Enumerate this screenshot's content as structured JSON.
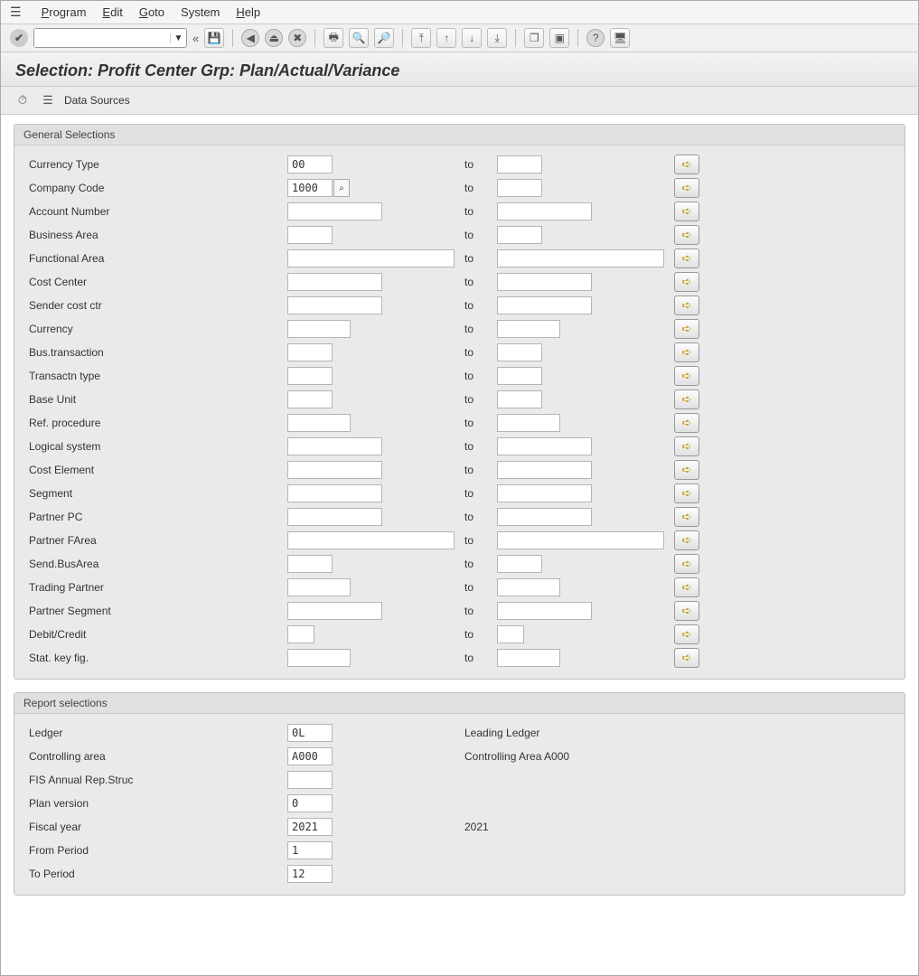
{
  "menubar": {
    "items": [
      "Program",
      "Edit",
      "Goto",
      "System",
      "Help"
    ]
  },
  "toolbar": {
    "combo_value": "",
    "chevrons": "«"
  },
  "title": "Selection: Profit Center Grp: Plan/Actual/Variance",
  "subtoolbar": {
    "data_sources": "Data Sources"
  },
  "general_selections": {
    "title": "General Selections",
    "to_label": "to",
    "rows": [
      {
        "label": "Currency Type",
        "from": "00",
        "from_w": "w2",
        "to_w": "w2",
        "f4": false
      },
      {
        "label": "Company Code",
        "from": "1000",
        "from_w": "w2",
        "to_w": "w2",
        "f4": true
      },
      {
        "label": "Account Number",
        "from": "",
        "from_w": "w4",
        "to_w": "w4",
        "f4": false
      },
      {
        "label": "Business Area",
        "from": "",
        "from_w": "w2",
        "to_w": "w2",
        "f4": false
      },
      {
        "label": "Functional Area",
        "from": "",
        "from_w": "w6",
        "to_w": "w6",
        "f4": false
      },
      {
        "label": "Cost Center",
        "from": "",
        "from_w": "w4",
        "to_w": "w4",
        "f4": false
      },
      {
        "label": "Sender cost ctr",
        "from": "",
        "from_w": "w4",
        "to_w": "w4",
        "f4": false
      },
      {
        "label": "Currency",
        "from": "",
        "from_w": "w3",
        "to_w": "w3",
        "f4": false
      },
      {
        "label": "Bus.transaction",
        "from": "",
        "from_w": "w2",
        "to_w": "w2",
        "f4": false
      },
      {
        "label": "Transactn type",
        "from": "",
        "from_w": "w2",
        "to_w": "w2",
        "f4": false
      },
      {
        "label": "Base Unit",
        "from": "",
        "from_w": "w2",
        "to_w": "w2",
        "f4": false
      },
      {
        "label": "Ref. procedure",
        "from": "",
        "from_w": "w3",
        "to_w": "w3",
        "f4": false
      },
      {
        "label": "Logical system",
        "from": "",
        "from_w": "w4",
        "to_w": "w4",
        "f4": false
      },
      {
        "label": "Cost Element",
        "from": "",
        "from_w": "w4",
        "to_w": "w4",
        "f4": false
      },
      {
        "label": "Segment",
        "from": "",
        "from_w": "w4",
        "to_w": "w4",
        "f4": false
      },
      {
        "label": "Partner PC",
        "from": "",
        "from_w": "w4",
        "to_w": "w4",
        "f4": false
      },
      {
        "label": "Partner FArea",
        "from": "",
        "from_w": "w6",
        "to_w": "w6",
        "f4": false
      },
      {
        "label": "Send.BusArea",
        "from": "",
        "from_w": "w2",
        "to_w": "w2",
        "f4": false
      },
      {
        "label": "Trading Partner",
        "from": "",
        "from_w": "w3",
        "to_w": "w3",
        "f4": false
      },
      {
        "label": "Partner Segment",
        "from": "",
        "from_w": "w4",
        "to_w": "w4",
        "f4": false
      },
      {
        "label": "Debit/Credit",
        "from": "",
        "from_w": "w1",
        "to_w": "w1",
        "f4": false
      },
      {
        "label": "Stat. key fig.",
        "from": "",
        "from_w": "w3",
        "to_w": "w3",
        "f4": false
      }
    ]
  },
  "report_selections": {
    "title": "Report selections",
    "rows": [
      {
        "label": "Ledger",
        "value": "0L",
        "w": "w2",
        "desc": "Leading Ledger"
      },
      {
        "label": "Controlling area",
        "value": "A000",
        "w": "w2",
        "desc": "Controlling Area A000"
      },
      {
        "label": "FIS Annual Rep.Struc",
        "value": "",
        "w": "w2",
        "desc": ""
      },
      {
        "label": "Plan version",
        "value": "0",
        "w": "w2",
        "desc": ""
      },
      {
        "label": "Fiscal year",
        "value": "2021",
        "w": "w2",
        "desc": "2021"
      },
      {
        "label": "From Period",
        "value": "1",
        "w": "w2",
        "desc": ""
      },
      {
        "label": "To Period",
        "value": "12",
        "w": "w2",
        "desc": ""
      }
    ]
  }
}
